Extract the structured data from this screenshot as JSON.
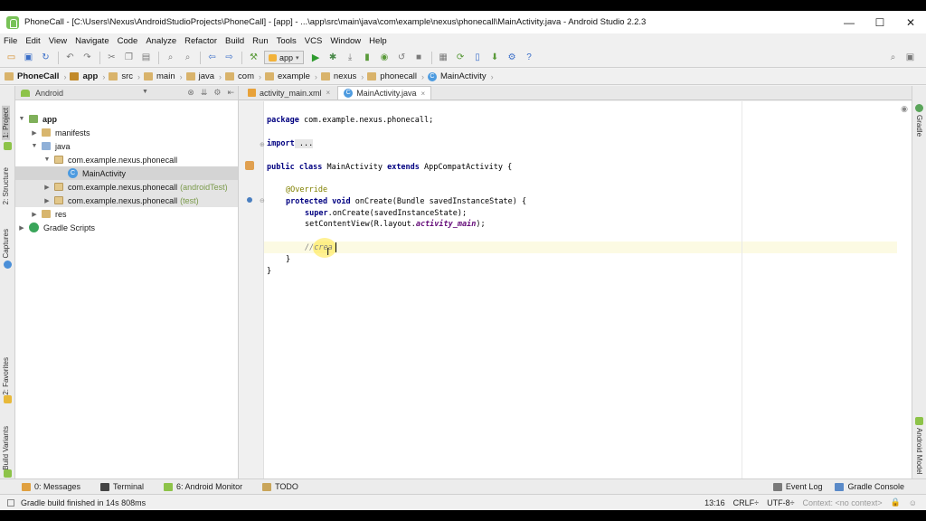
{
  "window": {
    "title": "PhoneCall - [C:\\Users\\Nexus\\AndroidStudioProjects\\PhoneCall] - [app] - ...\\app\\src\\main\\java\\com\\example\\nexus\\phonecall\\MainActivity.java - Android Studio 2.2.3",
    "controls": {
      "minimize": "—",
      "maximize": "☐",
      "close": "✕"
    }
  },
  "menu": [
    "File",
    "Edit",
    "View",
    "Navigate",
    "Code",
    "Analyze",
    "Refactor",
    "Build",
    "Run",
    "Tools",
    "VCS",
    "Window",
    "Help"
  ],
  "toolbar": {
    "run_config": "app",
    "run_config_arrow": "▾"
  },
  "breadcrumbs": [
    "PhoneCall",
    "app",
    "src",
    "main",
    "java",
    "com",
    "example",
    "nexus",
    "phonecall",
    "MainActivity"
  ],
  "project_panel": {
    "view_mode": "Android",
    "tree": [
      {
        "label": "app",
        "arrow": "▼"
      },
      {
        "label": "manifests",
        "arrow": "▶"
      },
      {
        "label": "java",
        "arrow": "▼"
      },
      {
        "label": "com.example.nexus.phonecall",
        "arrow": "▼"
      },
      {
        "label": "MainActivity",
        "icon_letter": "C"
      },
      {
        "label": "com.example.nexus.phonecall",
        "suffix": "(androidTest)",
        "arrow": "▶"
      },
      {
        "label": "com.example.nexus.phonecall",
        "suffix": "(test)",
        "arrow": "▶"
      },
      {
        "label": "res",
        "arrow": "▶"
      },
      {
        "label": "Gradle Scripts",
        "arrow": "▶"
      }
    ]
  },
  "editor": {
    "tabs": [
      {
        "label": "activity_main.xml",
        "close": "×"
      },
      {
        "label": "MainActivity.java",
        "close": "×",
        "active": true
      }
    ],
    "code": {
      "package_kw": "package",
      "package_name": " com.example.nexus.phonecall;",
      "import_kw": "import",
      "import_fold": " ...",
      "class_kw1": "public class",
      "class_name": " MainActivity ",
      "class_kw2": "extends",
      "class_rest": " AppCompatActivity {",
      "annotation": "@Override",
      "method_kw1": "protected void",
      "method_rest": " onCreate(Bundle savedInstanceState) {",
      "super_kw": "super",
      "super_rest": ".onCreate(savedInstanceState);",
      "set_content_a": "setContentView(R.layout.",
      "set_content_field": "activity_main",
      "set_content_b": ");",
      "comment": "//crea",
      "close_method": "}",
      "close_class": "}"
    }
  },
  "left_tool_tabs": [
    "1: Project",
    "2: Structure",
    "Captures",
    "2: Favorites",
    "Build Variants"
  ],
  "right_tool_tabs": [
    "Gradle",
    "Android Model"
  ],
  "bottom_tabs": [
    {
      "label": "0: Messages"
    },
    {
      "label": "Terminal"
    },
    {
      "label": "6: Android Monitor"
    },
    {
      "label": "TODO"
    }
  ],
  "bottom_right_tabs": [
    {
      "label": "Event Log"
    },
    {
      "label": "Gradle Console"
    }
  ],
  "status": {
    "message": "Gradle build finished in 14s 808ms",
    "position": "13:16",
    "line_separator": "CRLF÷",
    "encoding": "UTF-8÷",
    "context": "Context: <no context>"
  },
  "colors": {
    "accent_green": "#78c257",
    "keyword": "#000080",
    "annotation": "#808000",
    "caret_line": "#fcfae3"
  }
}
